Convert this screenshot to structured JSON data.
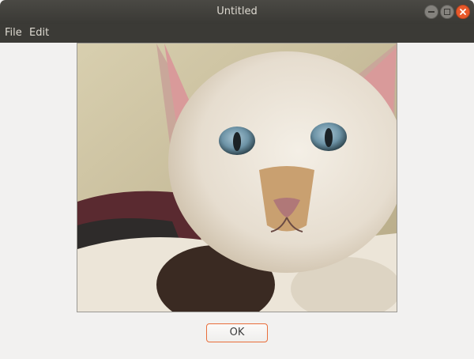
{
  "window": {
    "title": "Untitled"
  },
  "menu": {
    "items": [
      "File",
      "Edit"
    ]
  },
  "dialog": {
    "ok_label": "OK"
  },
  "colors": {
    "titlebar": "#3b3a36",
    "close": "#e9592b",
    "accent": "#e96e3b"
  }
}
